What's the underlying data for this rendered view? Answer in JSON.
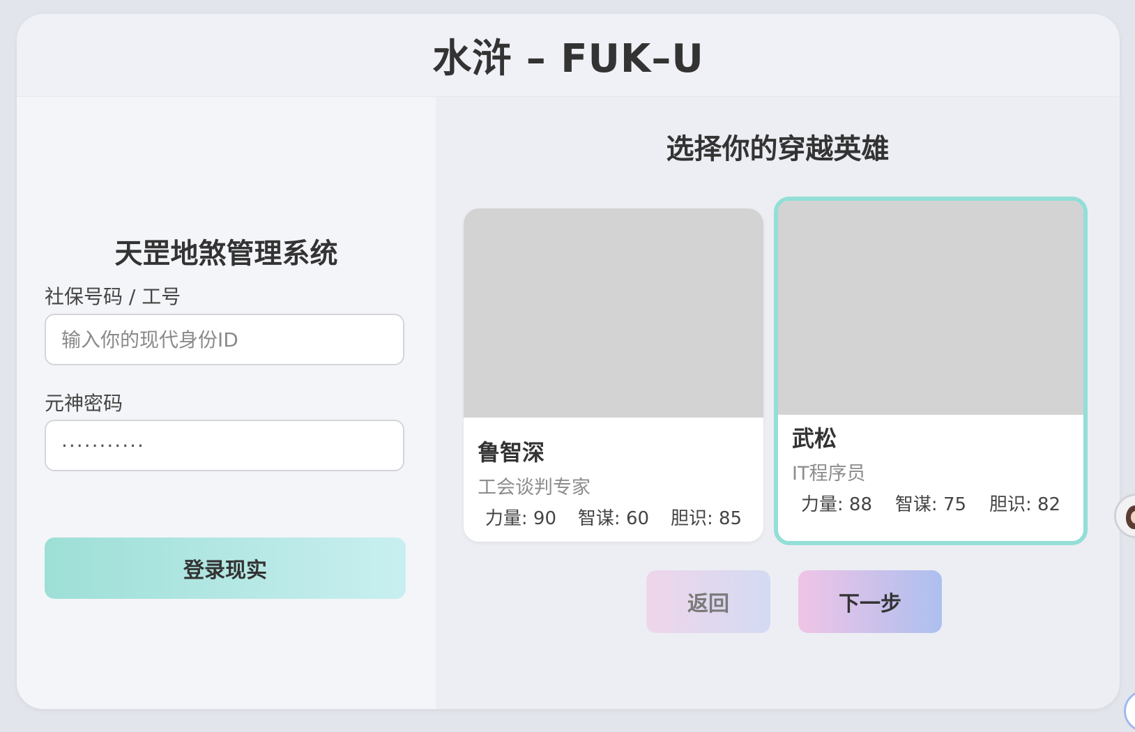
{
  "app": {
    "title": "水浒 – FUK–U"
  },
  "login": {
    "system_title": "天罡地煞管理系统",
    "id_label": "社保号码 / 工号",
    "id_placeholder": "输入你的现代身份ID",
    "password_label": "元神密码",
    "password_value": "···········",
    "login_button": "登录现实"
  },
  "hero_select": {
    "heading": "选择你的穿越英雄",
    "heroes": [
      {
        "name": "鲁智深",
        "role": "工会谈判专家",
        "selected": false,
        "stats": [
          "力量: 90",
          "智谋: 60",
          "胆识: 85"
        ]
      },
      {
        "name": "武松",
        "role": "IT程序员",
        "selected": true,
        "stats": [
          "力量: 88",
          "智谋: 75",
          "胆识: 82"
        ]
      }
    ],
    "back_button": "返回",
    "next_button": "下一步"
  },
  "colors": {
    "accent": "#93ded6",
    "login_gradient_start": "#9ddfd6",
    "login_gradient_end": "#c9eff0",
    "next_gradient_start": "#efc4e6",
    "next_gradient_end": "#adbfef",
    "image_placeholder": "#d3d3d3"
  },
  "icons": {
    "side_avatar": "user-avatar-icon",
    "corner_bubble": "assistant-bubble-icon"
  }
}
